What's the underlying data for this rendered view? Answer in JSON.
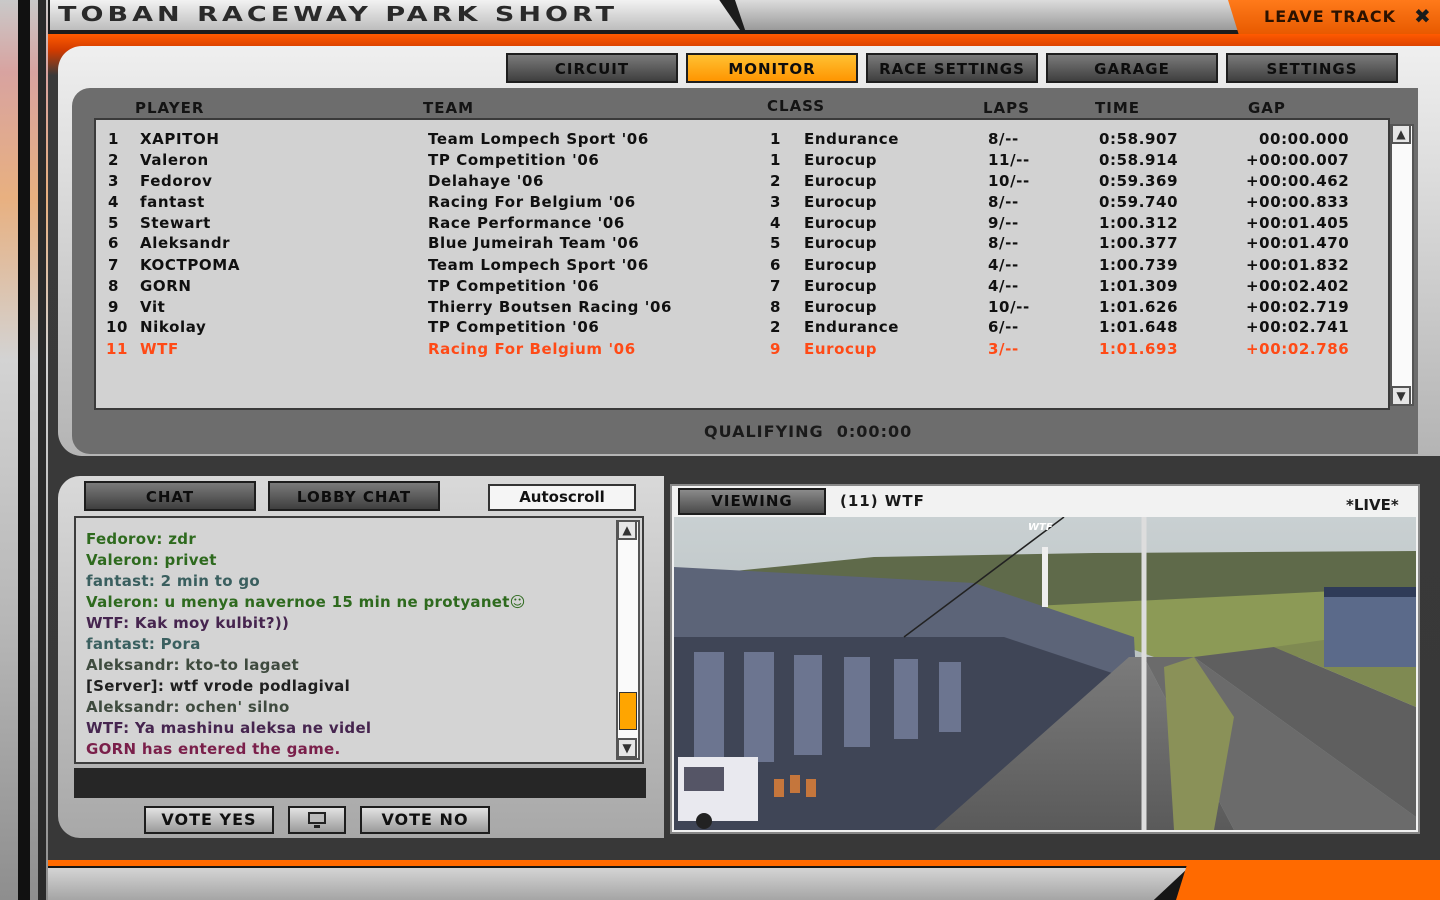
{
  "window": {
    "track_title": "TOBAN RACEWAY PARK SHORT",
    "leave_track_label": "LEAVE TRACK",
    "close_icon": "✖"
  },
  "tabs": [
    {
      "label": "CIRCUIT",
      "active": false
    },
    {
      "label": "MONITOR",
      "active": true
    },
    {
      "label": "RACE SETTINGS",
      "active": false
    },
    {
      "label": "GARAGE",
      "active": false
    },
    {
      "label": "SETTINGS",
      "active": false
    }
  ],
  "standings": {
    "headers": {
      "player": "PLAYER",
      "team": "TEAM",
      "class": "CLASS",
      "laps": "LAPS",
      "time": "TIME",
      "gap": "GAP"
    },
    "rows": [
      {
        "pos": "1",
        "player": "XAPITOH",
        "team": "Team Lompech Sport '06",
        "class_num": "1",
        "class": "Endurance",
        "laps": "8/--",
        "time": "0:58.907",
        "gap": "00:00.000"
      },
      {
        "pos": "2",
        "player": "Valeron",
        "team": "TP Competition '06",
        "class_num": "1",
        "class": "Eurocup",
        "laps": "11/--",
        "time": "0:58.914",
        "gap": "+00:00.007"
      },
      {
        "pos": "3",
        "player": "Fedorov",
        "team": "Delahaye '06",
        "class_num": "2",
        "class": "Eurocup",
        "laps": "10/--",
        "time": "0:59.369",
        "gap": "+00:00.462"
      },
      {
        "pos": "4",
        "player": "fantast",
        "team": "Racing For Belgium '06",
        "class_num": "3",
        "class": "Eurocup",
        "laps": "8/--",
        "time": "0:59.740",
        "gap": "+00:00.833"
      },
      {
        "pos": "5",
        "player": "Stewart",
        "team": "Race Performance '06",
        "class_num": "4",
        "class": "Eurocup",
        "laps": "9/--",
        "time": "1:00.312",
        "gap": "+00:01.405"
      },
      {
        "pos": "6",
        "player": "Aleksandr",
        "team": "Blue Jumeirah Team '06",
        "class_num": "5",
        "class": "Eurocup",
        "laps": "8/--",
        "time": "1:00.377",
        "gap": "+00:01.470"
      },
      {
        "pos": "7",
        "player": "KOCTPOMA",
        "team": "Team Lompech Sport '06",
        "class_num": "6",
        "class": "Eurocup",
        "laps": "4/--",
        "time": "1:00.739",
        "gap": "+00:01.832"
      },
      {
        "pos": "8",
        "player": "GORN",
        "team": "TP Competition '06",
        "class_num": "7",
        "class": "Eurocup",
        "laps": "4/--",
        "time": "1:01.309",
        "gap": "+00:02.402"
      },
      {
        "pos": "9",
        "player": "Vit",
        "team": "Thierry Boutsen Racing '06",
        "class_num": "8",
        "class": "Eurocup",
        "laps": "10/--",
        "time": "1:01.626",
        "gap": "+00:02.719"
      },
      {
        "pos": "10",
        "player": "Nikolay",
        "team": "TP Competition '06",
        "class_num": "2",
        "class": "Endurance",
        "laps": "6/--",
        "time": "1:01.648",
        "gap": "+00:02.741"
      },
      {
        "pos": "11",
        "player": "WTF",
        "team": "Racing For Belgium '06",
        "class_num": "9",
        "class": "Eurocup",
        "laps": "3/--",
        "time": "1:01.693",
        "gap": "+00:02.786",
        "highlight": true
      }
    ]
  },
  "session": {
    "label": "QUALIFYING",
    "time": "0:00:00"
  },
  "chat": {
    "tabs": [
      "CHAT",
      "LOBBY CHAT"
    ],
    "autoscroll_label": "Autoscroll",
    "messages": [
      {
        "text": "Fedorov: zdr",
        "color": "#2e6a1e"
      },
      {
        "text": "Valeron: privet",
        "color": "#2e6a1e"
      },
      {
        "text": "fantast: 2 min to go",
        "color": "#3a5f5f"
      },
      {
        "text": "Valeron: u menya navernoe 15 min ne protyanet☺",
        "color": "#2e6a1e"
      },
      {
        "text": "WTF: Kak moy kulbit?))",
        "color": "#46254f"
      },
      {
        "text": "fantast: Pora",
        "color": "#3a5f5f"
      },
      {
        "text": "Aleksandr: kto-to lagaet",
        "color": "#3f4b3f"
      },
      {
        "text": "[Server]: wtf vrode podlagival",
        "color": "#1f1f1f"
      },
      {
        "text": "Aleksandr: ochen' silno",
        "color": "#3f4b3f"
      },
      {
        "text": "WTF: Ya mashinu aleksa ne videl",
        "color": "#46254f"
      },
      {
        "text": "GORN has entered the game.",
        "color": "#7a1f4a"
      }
    ],
    "input_value": ""
  },
  "vote": {
    "yes_label": "VOTE YES",
    "no_label": "VOTE NO",
    "monitor_icon": "monitor-icon"
  },
  "viewer": {
    "viewing_label": "VIEWING",
    "target": "(11) WTF",
    "live_label": "*LIVE*",
    "car_tag": "WTF"
  },
  "colors": {
    "accent_orange": "#ff6a00",
    "active_tab": "#ffa500",
    "highlight_row": "#ff4a16"
  }
}
